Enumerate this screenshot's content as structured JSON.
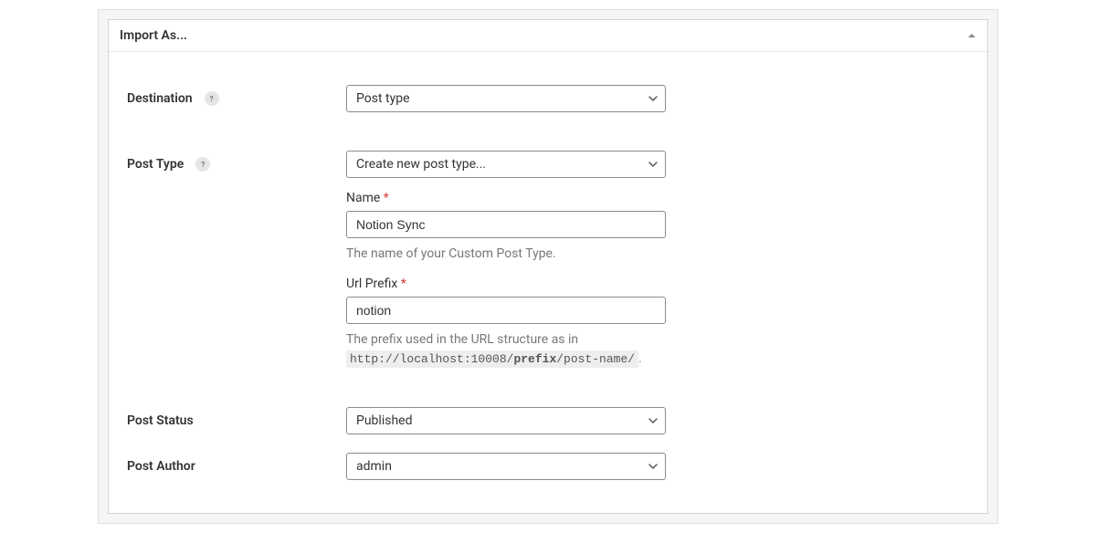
{
  "panel": {
    "title": "Import As..."
  },
  "fields": {
    "destination": {
      "label": "Destination",
      "help": "?",
      "value": "Post type"
    },
    "postType": {
      "label": "Post Type",
      "help": "?",
      "value": "Create new post type...",
      "nameLabel": "Name",
      "nameValue": "Notion Sync",
      "nameHelper": "The name of your Custom Post Type.",
      "urlPrefixLabel": "Url Prefix",
      "urlPrefixValue": "notion",
      "urlPrefixHelperPre": "The prefix used in the URL structure as in",
      "urlExampleBase": "http://localhost:10008/",
      "urlExamplePrefix": "prefix",
      "urlExampleSuffix": "/post-name/",
      "urlExampleTrail": "."
    },
    "postStatus": {
      "label": "Post Status",
      "value": "Published"
    },
    "postAuthor": {
      "label": "Post Author",
      "value": "admin"
    }
  }
}
